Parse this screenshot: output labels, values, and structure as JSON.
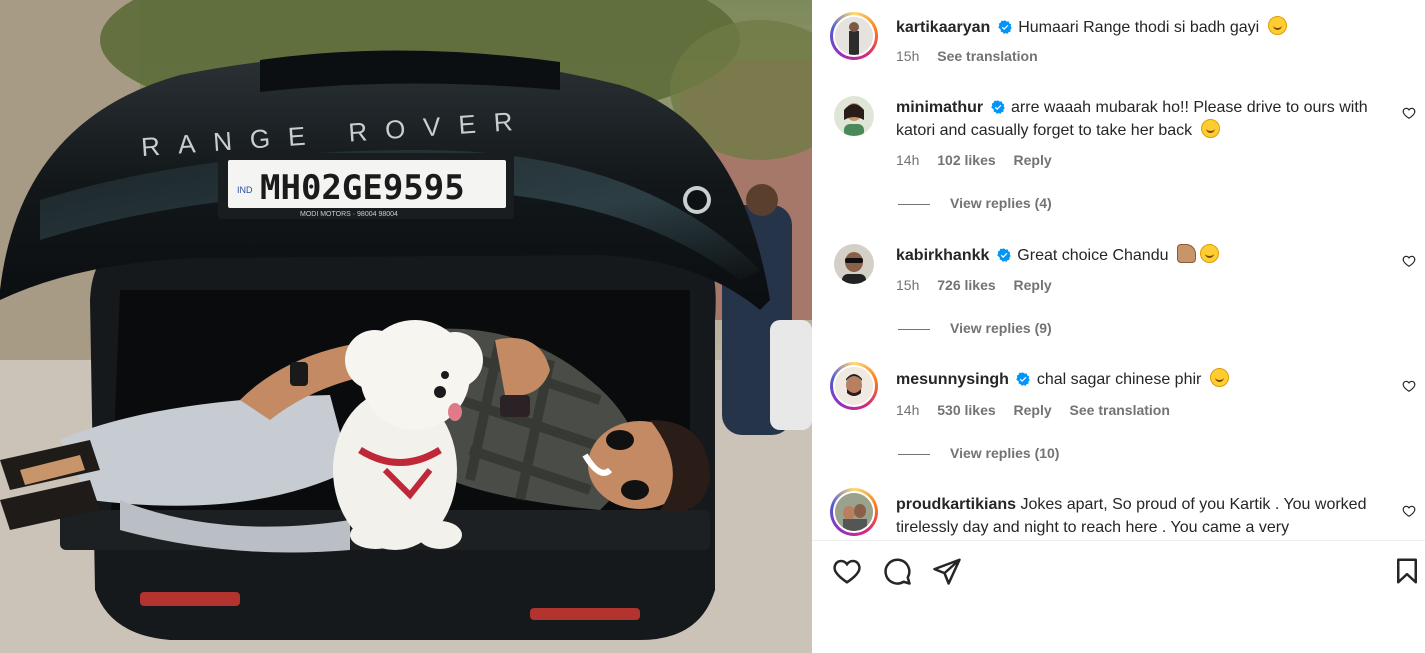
{
  "post": {
    "author": "kartikaaryan",
    "caption": "Humaari Range thodi si badh gayi",
    "time": "15h",
    "see_translation": "See translation"
  },
  "photo": {
    "brand_text": "RANGE ROVER",
    "plate": "MH02GE9595",
    "plate_prefix": "IND",
    "dealer": "MODI MOTORS · 98004 98004"
  },
  "comments": [
    {
      "user": "minimathur",
      "text": "arre waaah mubarak ho!! Please drive to ours with katori and casually forget to take her back",
      "time": "14h",
      "likes": "102 likes",
      "reply": "Reply",
      "view_replies": "View replies (4)"
    },
    {
      "user": "kabirkhankk",
      "text": "Great choice Chandu",
      "time": "15h",
      "likes": "726 likes",
      "reply": "Reply",
      "view_replies": "View replies (9)"
    },
    {
      "user": "mesunnysingh",
      "text": "chal sagar chinese phir",
      "time": "14h",
      "likes": "530 likes",
      "reply": "Reply",
      "see_translation": "See translation",
      "view_replies": "View replies (10)"
    },
    {
      "user": "proudkartikians",
      "text": "Jokes apart, So proud of you Kartik . You worked tirelessly day and night to reach here . You came a very"
    }
  ],
  "icons": {
    "like": "heart-icon",
    "comment": "comment-icon",
    "share": "share-icon",
    "save": "bookmark-icon",
    "verified": "verified-badge-icon"
  },
  "colors": {
    "verified": "#0095f6",
    "text": "#262626",
    "secondary": "#737373"
  }
}
